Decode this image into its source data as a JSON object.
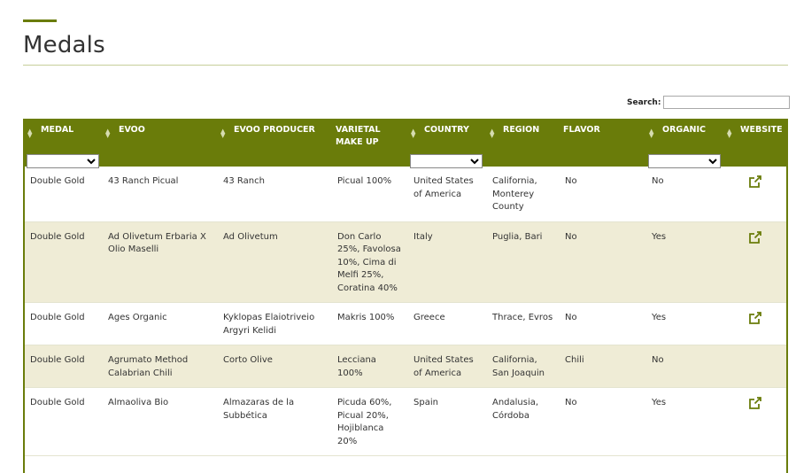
{
  "page": {
    "title": "Medals"
  },
  "search": {
    "label": "Search:",
    "value": ""
  },
  "table": {
    "columns": [
      "MEDAL",
      "EVOO",
      "EVOO PRODUCER",
      "VARIETAL MAKE UP",
      "COUNTRY",
      "REGION",
      "FLAVOR",
      "ORGANIC",
      "WEBSITE"
    ],
    "rows": [
      {
        "medal": "Double Gold",
        "evoo": "43 Ranch Picual",
        "producer": "43 Ranch",
        "varietal": "Picual 100%",
        "country": "United States of America",
        "region": "California, Monterey County",
        "flavor": "No",
        "organic": "No",
        "website": "external-link-icon"
      },
      {
        "medal": "Double Gold",
        "evoo": "Ad Olivetum Erbaria X Olio Maselli",
        "producer": "Ad Olivetum",
        "varietal": "Don Carlo 25%, Favolosa 10%, Cima di Melfi 25%, Coratina 40%",
        "country": "Italy",
        "region": "Puglia, Bari",
        "flavor": "No",
        "organic": "Yes",
        "website": "external-link-icon"
      },
      {
        "medal": "Double Gold",
        "evoo": "Ages Organic",
        "producer": "Kyklopas Elaiotriveio Argyri Kelidi",
        "varietal": "Makris 100%",
        "country": "Greece",
        "region": "Thrace, Evros",
        "flavor": "No",
        "organic": "Yes",
        "website": "external-link-icon"
      },
      {
        "medal": "Double Gold",
        "evoo": "Agrumato Method Calabrian Chili",
        "producer": "Corto Olive",
        "varietal": "Lecciana 100%",
        "country": "United States of America",
        "region": "California, San Joaquin",
        "flavor": "Chili",
        "organic": "No",
        "website": ""
      },
      {
        "medal": "Double Gold",
        "evoo": "Almaoliva Bio",
        "producer": "Almazaras de la Subbética",
        "varietal": "Picuda 60%, Picual 20%, Hojiblanca 20%",
        "country": "Spain",
        "region": "Andalusia, Córdoba",
        "flavor": "No",
        "organic": "Yes",
        "website": "external-link-icon"
      }
    ]
  },
  "colors": {
    "accent": "#6a7c0a",
    "row_alt": "#efecd6"
  }
}
